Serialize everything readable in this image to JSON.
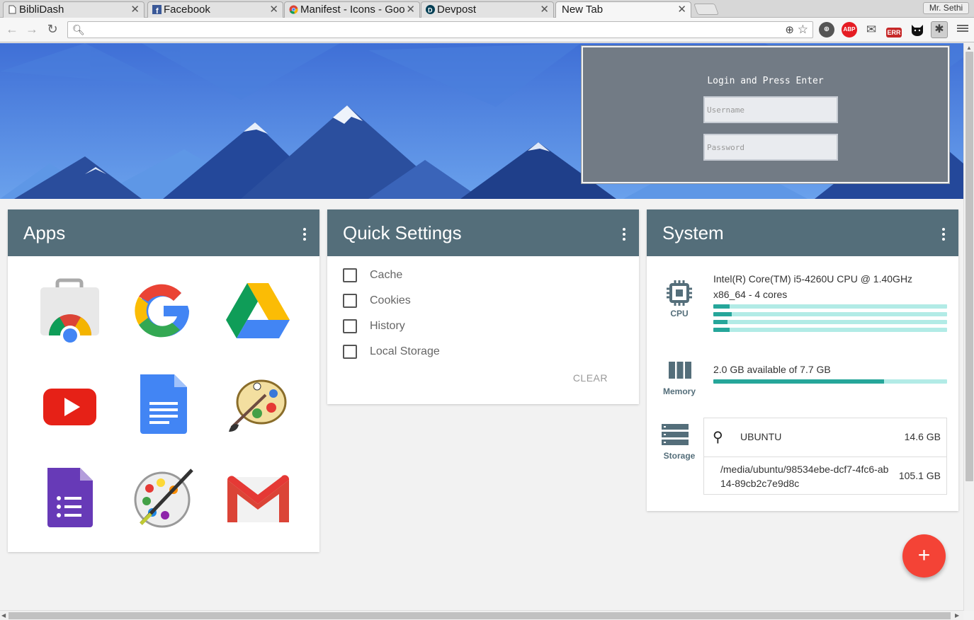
{
  "tabs": [
    {
      "label": "BibliDash",
      "icon": "page-icon"
    },
    {
      "label": "Facebook",
      "icon": "facebook-icon"
    },
    {
      "label": "Manifest - Icons - Goo",
      "icon": "chrome-icon"
    },
    {
      "label": "Devpost",
      "icon": "devpost-icon"
    },
    {
      "label": "New Tab",
      "active": true
    }
  ],
  "profile_name": "Mr. Sethi",
  "omnibox": {
    "value": ""
  },
  "extensions": [
    "globe-icon",
    "adblock-icon",
    "mail-icon",
    "error-icon",
    "cat-icon",
    "puzzle-icon"
  ],
  "extension_labels": {
    "adblock": "ABP",
    "error": "ERR"
  },
  "login_popup": {
    "title": "Login and Press Enter",
    "username_placeholder": "Username",
    "password_placeholder": "Password"
  },
  "apps_card": {
    "title": "Apps",
    "apps": [
      "web-store-icon",
      "google-icon",
      "google-drive-icon",
      "youtube-icon",
      "google-docs-icon",
      "paint-palette-icon",
      "google-forms-icon",
      "paint-app-icon",
      "gmail-icon"
    ]
  },
  "quick_settings": {
    "title": "Quick Settings",
    "items": [
      "Cache",
      "Cookies",
      "History",
      "Local Storage"
    ],
    "clear_label": "CLEAR"
  },
  "system": {
    "title": "System",
    "cpu_label": "CPU",
    "cpu_model": "Intel(R) Core(TM) i5-4260U CPU @ 1.40GHz",
    "cpu_arch": "x86_64 - 4 cores",
    "cpu_usage": [
      0.07,
      0.08,
      0.06,
      0.07
    ],
    "memory_label": "Memory",
    "memory_text": "2.0 GB available of 7.7 GB",
    "memory_used_fraction": 0.73,
    "storage_label": "Storage",
    "storage": [
      {
        "name": "UBUNTU",
        "size": "14.6 GB"
      },
      {
        "name": "/media/ubuntu/98534ebe-dcf7-4fc6-ab14-89cb2c7e9d8c",
        "size": "105.1 GB"
      }
    ]
  },
  "colors": {
    "card_header": "#546e7a",
    "bar_fill": "#26a69a",
    "bar_track": "#b2ebe6",
    "fab": "#f44336"
  }
}
